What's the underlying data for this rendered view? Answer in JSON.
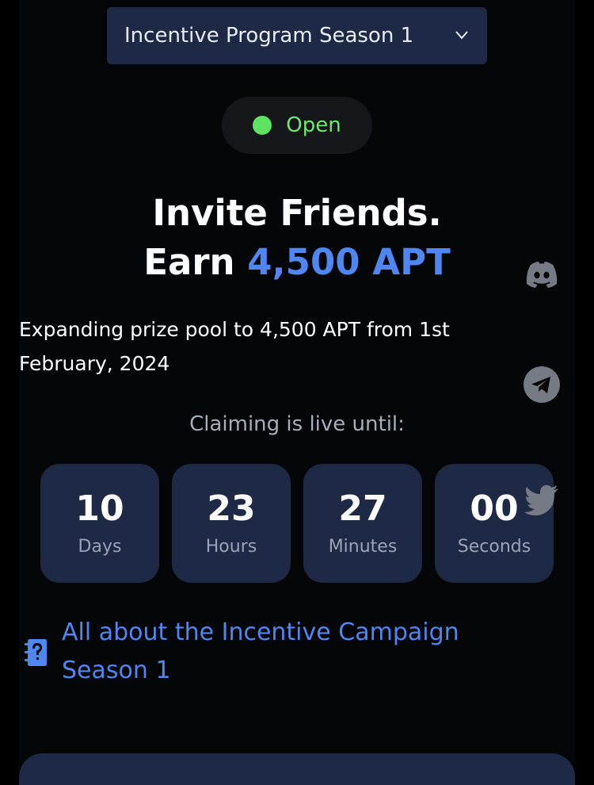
{
  "season_select": {
    "label": "Incentive Program Season 1",
    "icon": "chevron-down-icon"
  },
  "status": {
    "label": "Open",
    "color": "#5de262"
  },
  "hero": {
    "line1": "Invite Friends.",
    "line2_prefix": "Earn",
    "line2_accent": "4,500 APT",
    "accent_color": "#4f86f2"
  },
  "prize_description": "Expanding prize pool to 4,500 APT from 1st February, 2024",
  "claiming_label": "Claiming is live until:",
  "countdown": {
    "days": {
      "value": "10",
      "unit": "Days"
    },
    "hours": {
      "value": "23",
      "unit": "Hours"
    },
    "minutes": {
      "value": "27",
      "unit": "Minutes"
    },
    "seconds": {
      "value": "00",
      "unit": "Seconds"
    }
  },
  "social_links": [
    "discord-icon",
    "telegram-icon",
    "twitter-icon"
  ],
  "campaign_link": {
    "text": "All about the Incentive Campaign Season 1",
    "icon": "book-question-icon"
  }
}
